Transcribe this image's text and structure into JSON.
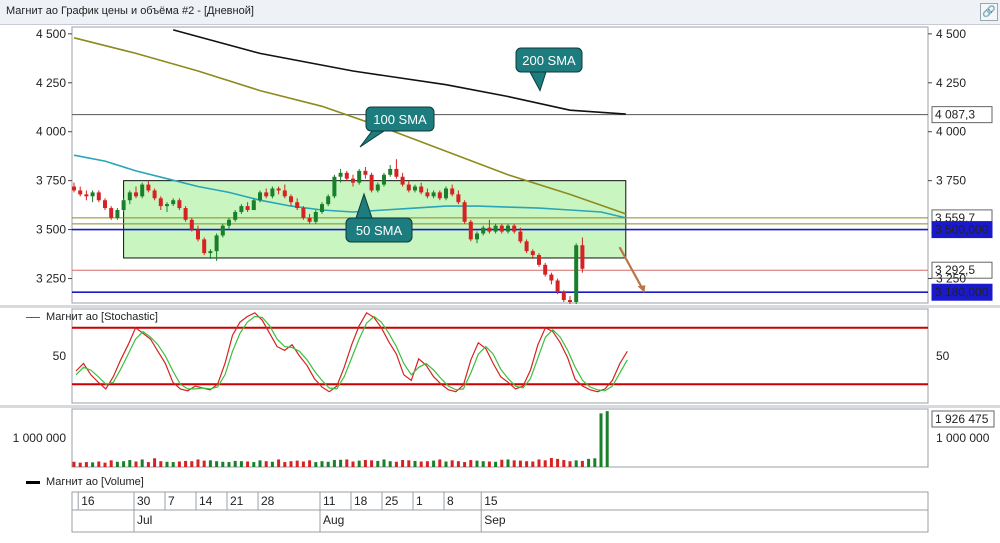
{
  "window": {
    "title": "Магнит ао График цены и объёма #2 - [Дневной]",
    "link_icon": "link-icon"
  },
  "colors": {
    "up": "#1a7f2a",
    "down": "#d52222",
    "sma50": "#2aa5b8",
    "sma100": "#8e8a1e",
    "sma200": "#111111",
    "box_fill": "#c9f5c0",
    "box_stroke": "#111111",
    "hline_blue": "#1a1acc",
    "hline_red": "#d66a6a",
    "callout": "#1d7c7e",
    "stoch_k": "#d52222",
    "stoch_d": "#3cbf3c",
    "stoch_level": "#cc0000",
    "arrow": "#b8764a"
  },
  "chart_data": [
    {
      "type": "candlestick",
      "panel": "price",
      "y_ticks_left": [
        "4 500",
        "4 250",
        "4 000",
        "3 750",
        "3 500",
        "3 250"
      ],
      "y_ticks_right": [
        "4 500",
        "4 250",
        "4 000",
        "3 750",
        "3 250"
      ],
      "y_tick_values": [
        4500,
        4250,
        4000,
        3750,
        3500,
        3250
      ],
      "ylim": [
        3125,
        4535
      ],
      "horizontal_lines": [
        {
          "label": "4 087,3",
          "value": 4087.3,
          "style": "thin-black"
        },
        {
          "label": "3 559,7",
          "value": 3559.7,
          "style": "thin-olive"
        },
        {
          "label": "3 500,000",
          "value": 3500,
          "style": "blue-highlight"
        },
        {
          "label": "3 292,5",
          "value": 3292.5,
          "style": "thin-red"
        },
        {
          "label": "3 180,000",
          "value": 3180,
          "style": "blue-highlight"
        }
      ],
      "box": {
        "from_index": 8,
        "to_index": 89,
        "top_value": 3750,
        "bottom_value": 3355
      },
      "annotations": [
        {
          "text": "200 SMA",
          "anchor_index": 69,
          "anchor_value": 4210
        },
        {
          "text": "100 SMA",
          "anchor_index": 42,
          "anchor_value": 3830
        },
        {
          "text": "50 SMA",
          "anchor_index": 43,
          "anchor_value": 3620
        }
      ],
      "ohlc": [
        [
          3720,
          3740,
          3690,
          3700
        ],
        [
          3700,
          3720,
          3670,
          3680
        ],
        [
          3680,
          3700,
          3650,
          3670
        ],
        [
          3670,
          3700,
          3640,
          3690
        ],
        [
          3690,
          3700,
          3640,
          3650
        ],
        [
          3650,
          3660,
          3600,
          3610
        ],
        [
          3610,
          3620,
          3550,
          3560
        ],
        [
          3560,
          3610,
          3550,
          3600
        ],
        [
          3600,
          3660,
          3590,
          3650
        ],
        [
          3650,
          3700,
          3630,
          3690
        ],
        [
          3690,
          3720,
          3660,
          3670
        ],
        [
          3670,
          3740,
          3660,
          3730
        ],
        [
          3730,
          3750,
          3690,
          3700
        ],
        [
          3700,
          3710,
          3650,
          3660
        ],
        [
          3660,
          3670,
          3600,
          3620
        ],
        [
          3620,
          3640,
          3590,
          3630
        ],
        [
          3630,
          3660,
          3620,
          3650
        ],
        [
          3650,
          3660,
          3600,
          3610
        ],
        [
          3610,
          3620,
          3540,
          3550
        ],
        [
          3550,
          3560,
          3490,
          3500
        ],
        [
          3500,
          3520,
          3440,
          3450
        ],
        [
          3450,
          3460,
          3370,
          3380
        ],
        [
          3380,
          3400,
          3350,
          3390
        ],
        [
          3390,
          3480,
          3340,
          3470
        ],
        [
          3470,
          3530,
          3460,
          3520
        ],
        [
          3520,
          3560,
          3500,
          3550
        ],
        [
          3550,
          3600,
          3540,
          3590
        ],
        [
          3590,
          3630,
          3580,
          3620
        ],
        [
          3620,
          3640,
          3590,
          3600
        ],
        [
          3600,
          3660,
          3600,
          3650
        ],
        [
          3650,
          3700,
          3640,
          3690
        ],
        [
          3690,
          3710,
          3660,
          3670
        ],
        [
          3670,
          3720,
          3660,
          3710
        ],
        [
          3710,
          3720,
          3680,
          3700
        ],
        [
          3700,
          3730,
          3660,
          3670
        ],
        [
          3670,
          3680,
          3620,
          3640
        ],
        [
          3640,
          3660,
          3600,
          3610
        ],
        [
          3610,
          3620,
          3550,
          3560
        ],
        [
          3560,
          3580,
          3530,
          3540
        ],
        [
          3540,
          3600,
          3530,
          3590
        ],
        [
          3590,
          3640,
          3580,
          3630
        ],
        [
          3630,
          3680,
          3620,
          3670
        ],
        [
          3670,
          3780,
          3660,
          3770
        ],
        [
          3770,
          3810,
          3740,
          3790
        ],
        [
          3790,
          3800,
          3750,
          3760
        ],
        [
          3760,
          3780,
          3720,
          3740
        ],
        [
          3740,
          3810,
          3730,
          3800
        ],
        [
          3800,
          3820,
          3760,
          3780
        ],
        [
          3780,
          3790,
          3690,
          3700
        ],
        [
          3700,
          3740,
          3690,
          3730
        ],
        [
          3730,
          3790,
          3720,
          3780
        ],
        [
          3780,
          3830,
          3770,
          3810
        ],
        [
          3810,
          3860,
          3760,
          3770
        ],
        [
          3770,
          3790,
          3720,
          3730
        ],
        [
          3730,
          3750,
          3690,
          3700
        ],
        [
          3700,
          3730,
          3690,
          3720
        ],
        [
          3720,
          3740,
          3680,
          3690
        ],
        [
          3690,
          3710,
          3660,
          3670
        ],
        [
          3670,
          3700,
          3660,
          3690
        ],
        [
          3690,
          3700,
          3650,
          3660
        ],
        [
          3660,
          3720,
          3650,
          3710
        ],
        [
          3710,
          3730,
          3670,
          3680
        ],
        [
          3680,
          3700,
          3630,
          3640
        ],
        [
          3640,
          3650,
          3530,
          3540
        ],
        [
          3540,
          3550,
          3440,
          3450
        ],
        [
          3450,
          3490,
          3430,
          3480
        ],
        [
          3480,
          3520,
          3470,
          3510
        ],
        [
          3510,
          3550,
          3480,
          3490
        ],
        [
          3490,
          3530,
          3480,
          3520
        ],
        [
          3520,
          3530,
          3480,
          3490
        ],
        [
          3490,
          3530,
          3480,
          3520
        ],
        [
          3520,
          3530,
          3480,
          3490
        ],
        [
          3490,
          3510,
          3430,
          3440
        ],
        [
          3440,
          3450,
          3380,
          3390
        ],
        [
          3390,
          3400,
          3350,
          3370
        ],
        [
          3370,
          3380,
          3310,
          3320
        ],
        [
          3320,
          3330,
          3260,
          3270
        ],
        [
          3270,
          3280,
          3220,
          3240
        ],
        [
          3240,
          3250,
          3170,
          3180
        ],
        [
          3180,
          3190,
          3130,
          3140
        ],
        [
          3140,
          3160,
          3120,
          3130
        ],
        [
          3130,
          3430,
          3120,
          3420
        ],
        [
          3420,
          3460,
          3280,
          3300
        ]
      ],
      "sma50": [
        [
          0,
          3880
        ],
        [
          5,
          3850
        ],
        [
          10,
          3800
        ],
        [
          15,
          3760
        ],
        [
          20,
          3720
        ],
        [
          25,
          3690
        ],
        [
          30,
          3650
        ],
        [
          35,
          3620
        ],
        [
          40,
          3600
        ],
        [
          45,
          3590
        ],
        [
          50,
          3600
        ],
        [
          55,
          3610
        ],
        [
          60,
          3620
        ],
        [
          65,
          3620
        ],
        [
          70,
          3615
        ],
        [
          75,
          3610
        ],
        [
          80,
          3600
        ],
        [
          85,
          3590
        ],
        [
          89,
          3560
        ]
      ],
      "sma100": [
        [
          0,
          4480
        ],
        [
          10,
          4400
        ],
        [
          20,
          4310
        ],
        [
          30,
          4210
        ],
        [
          40,
          4130
        ],
        [
          50,
          4020
        ],
        [
          60,
          3900
        ],
        [
          70,
          3780
        ],
        [
          80,
          3680
        ],
        [
          89,
          3580
        ]
      ],
      "sma200": [
        [
          16,
          4520
        ],
        [
          30,
          4400
        ],
        [
          45,
          4310
        ],
        [
          60,
          4240
        ],
        [
          70,
          4180
        ],
        [
          80,
          4110
        ],
        [
          89,
          4090
        ]
      ],
      "projection_arrow": {
        "from": [
          88,
          3410
        ],
        "to": [
          92,
          3180
        ]
      }
    },
    {
      "type": "line",
      "panel": "stochastic",
      "legend": "Магнит ао [Stochastic]",
      "y_ticks_left": [
        "50"
      ],
      "y_ticks_right": [
        "50"
      ],
      "ylim": [
        0,
        100
      ],
      "levels": [
        80,
        20
      ],
      "series": [
        {
          "key": "k",
          "values": [
            34,
            42,
            30,
            22,
            15,
            28,
            46,
            62,
            80,
            74,
            68,
            55,
            42,
            22,
            15,
            13,
            18,
            16,
            14,
            20,
            42,
            72,
            86,
            92,
            96,
            88,
            74,
            60,
            56,
            62,
            50,
            40,
            26,
            17,
            12,
            18,
            38,
            62,
            82,
            96,
            91,
            80,
            65,
            52,
            30,
            24,
            47,
            40,
            28,
            20,
            14,
            12,
            19,
            46,
            64,
            58,
            42,
            28,
            22,
            15,
            18,
            35,
            62,
            80,
            76,
            64,
            48,
            25,
            18,
            14,
            12,
            15,
            24,
            42,
            55
          ]
        },
        {
          "key": "d",
          "values": [
            30,
            38,
            35,
            28,
            20,
            22,
            36,
            52,
            68,
            76,
            70,
            62,
            50,
            34,
            20,
            15,
            15,
            16,
            15,
            17,
            30,
            55,
            74,
            86,
            92,
            91,
            82,
            68,
            60,
            59,
            55,
            46,
            34,
            24,
            16,
            15,
            28,
            48,
            68,
            85,
            92,
            86,
            74,
            60,
            42,
            30,
            38,
            42,
            35,
            26,
            18,
            14,
            15,
            32,
            52,
            60,
            52,
            36,
            26,
            18,
            16,
            26,
            48,
            70,
            78,
            70,
            56,
            38,
            24,
            17,
            14,
            13,
            18,
            32,
            46
          ]
        }
      ]
    },
    {
      "type": "bar",
      "panel": "volume",
      "legend": "Магнит ао [Volume]",
      "y_ticks_left": [
        "1 000 000"
      ],
      "y_ticks_right": [
        "1 000 000"
      ],
      "last_value_label": "1 926 475",
      "ylim": [
        0,
        2000000
      ],
      "values": [
        180000,
        150000,
        170000,
        160000,
        190000,
        150000,
        230000,
        180000,
        200000,
        240000,
        190000,
        260000,
        170000,
        300000,
        200000,
        180000,
        170000,
        190000,
        210000,
        200000,
        260000,
        220000,
        230000,
        200000,
        180000,
        170000,
        210000,
        200000,
        190000,
        170000,
        230000,
        200000,
        180000,
        260000,
        170000,
        200000,
        220000,
        190000,
        230000,
        170000,
        200000,
        180000,
        240000,
        250000,
        260000,
        190000,
        220000,
        240000,
        230000,
        210000,
        260000,
        200000,
        180000,
        240000,
        230000,
        210000,
        190000,
        200000,
        220000,
        260000,
        190000,
        230000,
        200000,
        170000,
        240000,
        220000,
        200000,
        190000,
        180000,
        250000,
        260000,
        230000,
        220000,
        200000,
        190000,
        260000,
        230000,
        310000,
        280000,
        240000,
        200000,
        230000,
        210000,
        280000,
        300000,
        1850000,
        1926475
      ]
    }
  ],
  "x_axis": {
    "day_labels": [
      "16",
      "30",
      "7",
      "14",
      "21",
      "28",
      "11",
      "18",
      "25",
      "1",
      "8",
      "15"
    ],
    "month_labels": [
      "Jul",
      "Aug",
      "Sep"
    ]
  }
}
